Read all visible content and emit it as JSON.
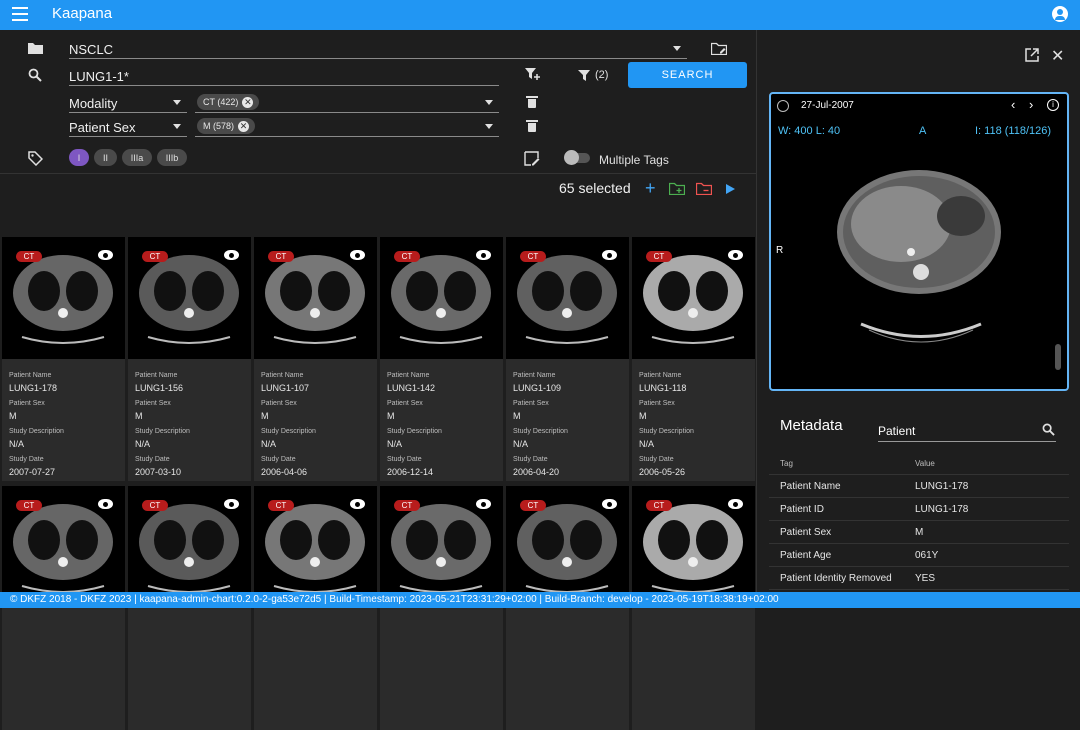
{
  "app": {
    "title": "Kaapana"
  },
  "filters": {
    "collection": "NSCLC",
    "query": "LUNG1-1*",
    "search_label": "SEARCH",
    "filter_count": "(2)",
    "rows": [
      {
        "field": "Modality",
        "chip": "CT (422)"
      },
      {
        "field": "Patient Sex",
        "chip": "M (578)"
      }
    ]
  },
  "tags": {
    "items": [
      "I",
      "II",
      "IIIa",
      "IIIb"
    ],
    "multiple_label": "Multiple Tags"
  },
  "selection": {
    "count_label": "65 selected"
  },
  "cards": [
    {
      "badge": "CT",
      "name": "LUNG1-178",
      "sex": "M",
      "desc": "N/A",
      "date": "2007-07-27"
    },
    {
      "badge": "CT",
      "name": "LUNG1-156",
      "sex": "M",
      "desc": "N/A",
      "date": "2007-03-10"
    },
    {
      "badge": "CT",
      "name": "LUNG1-107",
      "sex": "M",
      "desc": "N/A",
      "date": "2006-04-06"
    },
    {
      "badge": "CT",
      "name": "LUNG1-142",
      "sex": "M",
      "desc": "N/A",
      "date": "2006-12-14"
    },
    {
      "badge": "CT",
      "name": "LUNG1-109",
      "sex": "M",
      "desc": "N/A",
      "date": "2006-04-20"
    },
    {
      "badge": "CT",
      "name": "LUNG1-118",
      "sex": "M",
      "desc": "N/A",
      "date": "2006-05-26"
    },
    {
      "badge": "CT",
      "name": "",
      "sex": "",
      "desc": "",
      "date": ""
    },
    {
      "badge": "CT",
      "name": "",
      "sex": "",
      "desc": "",
      "date": ""
    },
    {
      "badge": "CT",
      "name": "",
      "sex": "",
      "desc": "",
      "date": ""
    },
    {
      "badge": "CT",
      "name": "",
      "sex": "",
      "desc": "",
      "date": ""
    },
    {
      "badge": "CT",
      "name": "",
      "sex": "",
      "desc": "",
      "date": ""
    },
    {
      "badge": "CT",
      "name": "",
      "sex": "",
      "desc": "",
      "date": ""
    }
  ],
  "card_labels": {
    "name": "Patient Name",
    "sex": "Patient Sex",
    "desc": "Study Description",
    "date": "Study Date"
  },
  "viewer": {
    "date": "27-Jul-2007",
    "window": "W: 400  L: 40",
    "orientation_top": "A",
    "orientation_left": "R",
    "slice": "I: 118 (118/126)"
  },
  "metadata": {
    "title": "Metadata",
    "search": "Patient",
    "col_tag": "Tag",
    "col_value": "Value",
    "rows": [
      {
        "tag": "Patient Name",
        "value": "LUNG1-178"
      },
      {
        "tag": "Patient ID",
        "value": "LUNG1-178"
      },
      {
        "tag": "Patient Sex",
        "value": "M"
      },
      {
        "tag": "Patient Age",
        "value": "061Y"
      },
      {
        "tag": "Patient Identity Removed",
        "value": "YES"
      }
    ]
  },
  "footer": {
    "text": "© DKFZ 2018 - DKFZ 2023 | kaapana-admin-chart:0.2.0-2-ga53e72d5 | Build-Timestamp: 2023-05-21T23:31:29+02:00 | Build-Branch: develop - 2023-05-19T18:38:19+02:00"
  },
  "colors": {
    "primary": "#2196f3",
    "badge": "#b71c1c",
    "viewer_border": "#64b5f6",
    "annotation": "#4fc3f7"
  }
}
